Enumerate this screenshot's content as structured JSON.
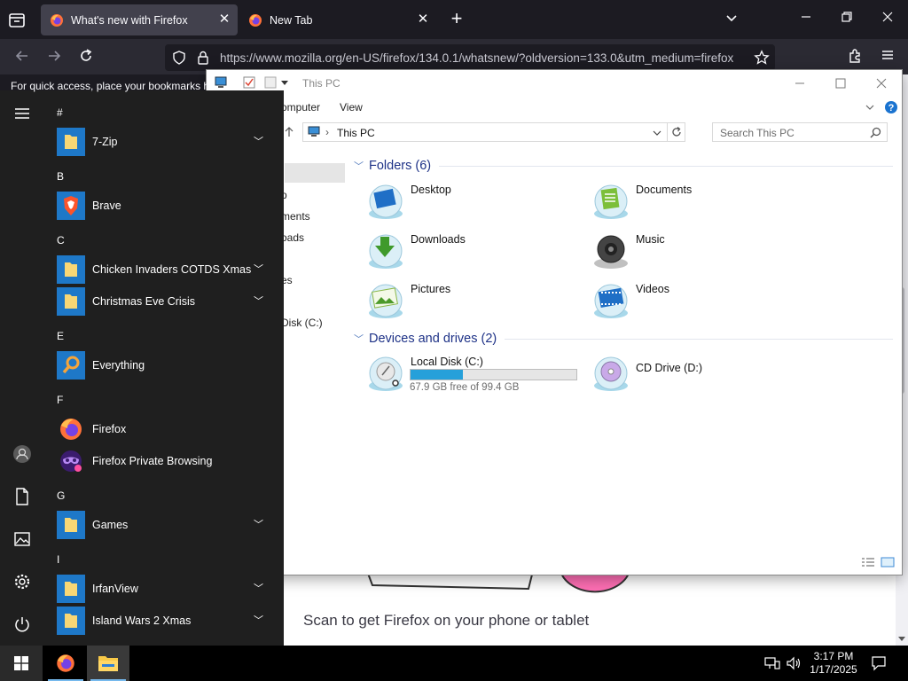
{
  "browser": {
    "tabs": [
      {
        "title": "What's new with Firefox",
        "active": true
      },
      {
        "title": "New Tab",
        "active": false
      }
    ],
    "url": "https://www.mozilla.org/en-US/firefox/134.0.1/whatsnew/?oldversion=133.0&utm_medium=firefox",
    "bookmarks_hint": "For quick access, place your bookmarks h",
    "page_text": "Scan to get Firefox on your phone or tablet",
    "colors": {
      "chrome_dark": "#1c1b22",
      "toolbar": "#2b2a33",
      "active_tab": "#42414d"
    }
  },
  "explorer": {
    "title": "This PC",
    "ribbon": [
      "omputer",
      "View"
    ],
    "address": "This PC",
    "search_placeholder": "Search This PC",
    "nav_partial": [
      "p",
      "ments",
      "oads",
      "es",
      "Disk (C:)"
    ],
    "folders_header": "Folders (6)",
    "folders": [
      {
        "name": "Desktop",
        "icon": "desktop-folder-icon"
      },
      {
        "name": "Documents",
        "icon": "documents-folder-icon"
      },
      {
        "name": "Downloads",
        "icon": "downloads-folder-icon"
      },
      {
        "name": "Music",
        "icon": "music-folder-icon"
      },
      {
        "name": "Pictures",
        "icon": "pictures-folder-icon"
      },
      {
        "name": "Videos",
        "icon": "videos-folder-icon"
      }
    ],
    "drives_header": "Devices and drives (2)",
    "drives": [
      {
        "name": "Local Disk (C:)",
        "free": "67.9 GB free of 99.4 GB",
        "used_fraction": 0.317
      },
      {
        "name": "CD Drive (D:)"
      }
    ],
    "accent": "#26a0da"
  },
  "start_menu": {
    "sections": [
      {
        "letter": "#",
        "apps": [
          {
            "name": "7-Zip",
            "icon": "folder-tile-icon",
            "expandable": true
          }
        ]
      },
      {
        "letter": "B",
        "apps": [
          {
            "name": "Brave",
            "icon": "brave-icon",
            "expandable": false
          }
        ]
      },
      {
        "letter": "C",
        "apps": [
          {
            "name": "Chicken Invaders COTDS Xmas",
            "icon": "folder-tile-icon",
            "expandable": true
          },
          {
            "name": "Christmas Eve Crisis",
            "icon": "folder-tile-icon",
            "expandable": true
          }
        ]
      },
      {
        "letter": "E",
        "apps": [
          {
            "name": "Everything",
            "icon": "everything-search-icon",
            "expandable": false
          }
        ]
      },
      {
        "letter": "F",
        "apps": [
          {
            "name": "Firefox",
            "icon": "firefox-icon",
            "expandable": false
          },
          {
            "name": "Firefox Private Browsing",
            "icon": "firefox-private-icon",
            "expandable": false
          }
        ]
      },
      {
        "letter": "G",
        "apps": [
          {
            "name": "Games",
            "icon": "folder-tile-icon",
            "expandable": true
          }
        ]
      },
      {
        "letter": "I",
        "apps": [
          {
            "name": "IrfanView",
            "icon": "folder-tile-icon",
            "expandable": true
          },
          {
            "name": "Island Wars 2 Xmas",
            "icon": "folder-tile-icon",
            "expandable": true
          }
        ]
      }
    ],
    "tile_color": "#1e78c8"
  },
  "taskbar": {
    "time": "3:17 PM",
    "date": "1/17/2025"
  }
}
